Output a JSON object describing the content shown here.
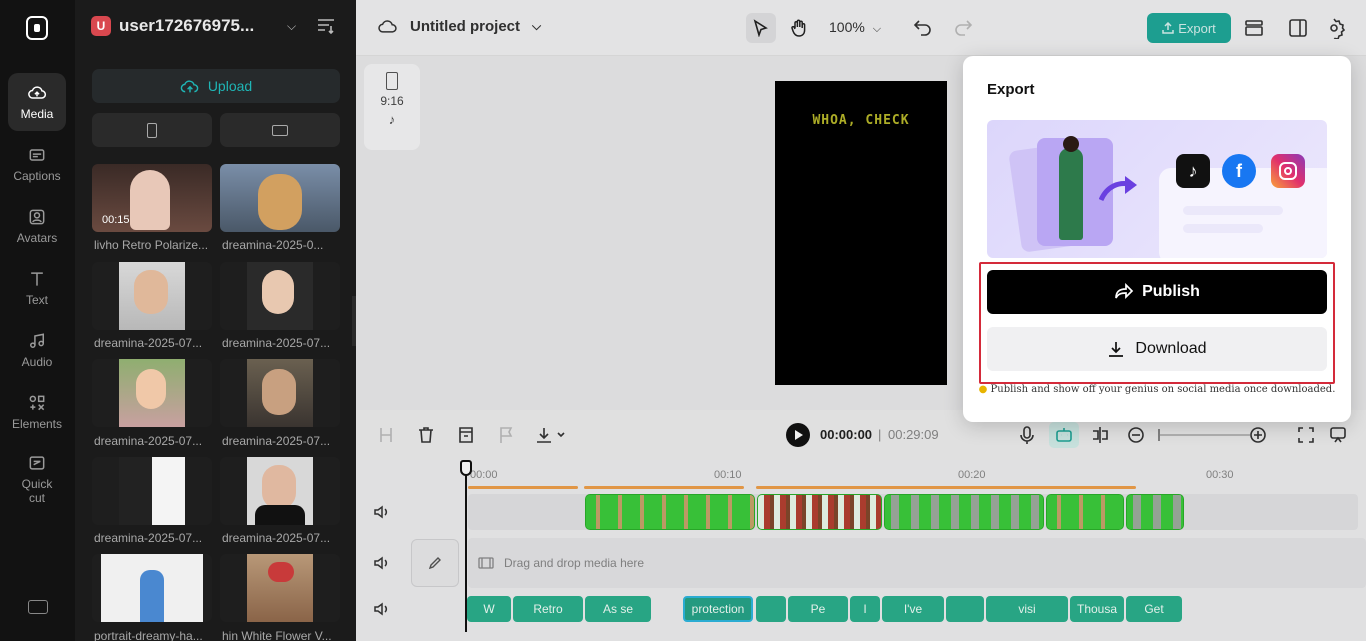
{
  "sidebar": {
    "items": [
      {
        "label": "Media"
      },
      {
        "label": "Captions"
      },
      {
        "label": "Avatars"
      },
      {
        "label": "Text"
      },
      {
        "label": "Audio"
      },
      {
        "label": "Elements"
      },
      {
        "label": "Quick cut"
      }
    ]
  },
  "account": {
    "initial": "U",
    "name": "user172676975..."
  },
  "media": {
    "upload_label": "Upload",
    "items": [
      {
        "caption": "livho Retro Polarize...",
        "duration": "00:15"
      },
      {
        "caption": "dreamina-2025-0..."
      },
      {
        "caption": "dreamina-2025-07..."
      },
      {
        "caption": "dreamina-2025-07..."
      },
      {
        "caption": "dreamina-2025-07..."
      },
      {
        "caption": "dreamina-2025-07..."
      },
      {
        "caption": "dreamina-2025-07..."
      },
      {
        "caption": "dreamina-2025-07..."
      },
      {
        "caption": "portrait-dreamy-ha..."
      },
      {
        "caption": "hin White Flower V..."
      }
    ]
  },
  "header": {
    "project_title": "Untitled project",
    "zoom": "100%",
    "export_label": "Export"
  },
  "canvas": {
    "ratio": "9:16",
    "preview_text": "WHOA, CHECK"
  },
  "player": {
    "current_time": "00:00:00",
    "separator": "|",
    "total_time": "00:29:09"
  },
  "timeline": {
    "ticks": [
      "00:00",
      "00:10",
      "00:20",
      "00:30"
    ],
    "drop_hint": "Drag and drop media here",
    "captions": [
      "W",
      "Retro",
      "As se",
      "protection",
      "",
      "Pe",
      "I",
      "I've",
      "",
      "visi",
      "Thousa",
      "Get"
    ]
  },
  "export_panel": {
    "title": "Export",
    "publish_label": "Publish",
    "download_label": "Download",
    "tip": "Publish and show off your genius on social media once downloaded."
  },
  "colors": {
    "accent": "#1fa89a",
    "highlight": "#d42a3a"
  }
}
